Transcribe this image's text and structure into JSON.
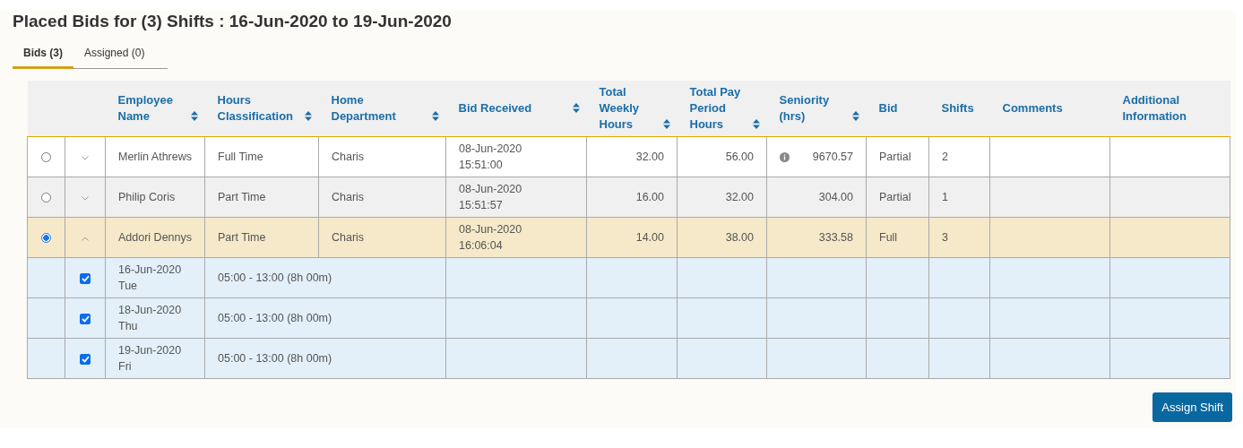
{
  "title": "Placed Bids for (3) Shifts : 16-Jun-2020 to 19-Jun-2020",
  "tabs": [
    {
      "label": "Bids (3)",
      "selected": true
    },
    {
      "label": "Assigned (0)",
      "selected": false
    }
  ],
  "table": {
    "columns": [
      {
        "label": "Employee Name",
        "sortable": true
      },
      {
        "label": "Hours Classification",
        "sortable": true
      },
      {
        "label": "Home Department",
        "sortable": true
      },
      {
        "label": "Bid Received",
        "sortable": true
      },
      {
        "label": "Total Weekly Hours",
        "sortable": true
      },
      {
        "label": "Total Pay Period Hours",
        "sortable": true
      },
      {
        "label": "Seniority (hrs)",
        "sortable": true
      },
      {
        "label": "Bid",
        "sortable": false
      },
      {
        "label": "Shifts",
        "sortable": false
      },
      {
        "label": "Comments",
        "sortable": false
      },
      {
        "label": "Additional Information",
        "sortable": false
      }
    ],
    "rows": [
      {
        "selected": false,
        "expanded": false,
        "name": "Merlin Athrews",
        "hours_classification": "Full Time",
        "department": "Charis",
        "bid_date": "08-Jun-2020",
        "bid_time": "15:51:00",
        "weekly_hours": "32.00",
        "pay_period_hours": "56.00",
        "seniority_info": true,
        "seniority": "9670.57",
        "bid": "Partial",
        "shifts": "2"
      },
      {
        "selected": false,
        "expanded": false,
        "name": "Philip Coris",
        "hours_classification": "Part Time",
        "department": "Charis",
        "bid_date": "08-Jun-2020",
        "bid_time": "15:51:57",
        "weekly_hours": "16.00",
        "pay_period_hours": "32.00",
        "seniority_info": false,
        "seniority": "304.00",
        "bid": "Partial",
        "shifts": "1"
      },
      {
        "selected": true,
        "expanded": true,
        "name": "Addori Dennys",
        "hours_classification": "Part Time",
        "department": "Charis",
        "bid_date": "08-Jun-2020",
        "bid_time": "16:06:04",
        "weekly_hours": "14.00",
        "pay_period_hours": "38.00",
        "seniority_info": false,
        "seniority": "333.58",
        "bid": "Full",
        "shifts": "3",
        "children": [
          {
            "checked": true,
            "date": "16-Jun-2020",
            "day": "Tue",
            "time": "05:00 - 13:00 (8h 00m)"
          },
          {
            "checked": true,
            "date": "18-Jun-2020",
            "day": "Thu",
            "time": "05:00 - 13:00 (8h 00m)"
          },
          {
            "checked": true,
            "date": "19-Jun-2020",
            "day": "Fri",
            "time": "05:00 - 13:00 (8h 00m)"
          }
        ]
      }
    ]
  },
  "button": "Assign Shift"
}
